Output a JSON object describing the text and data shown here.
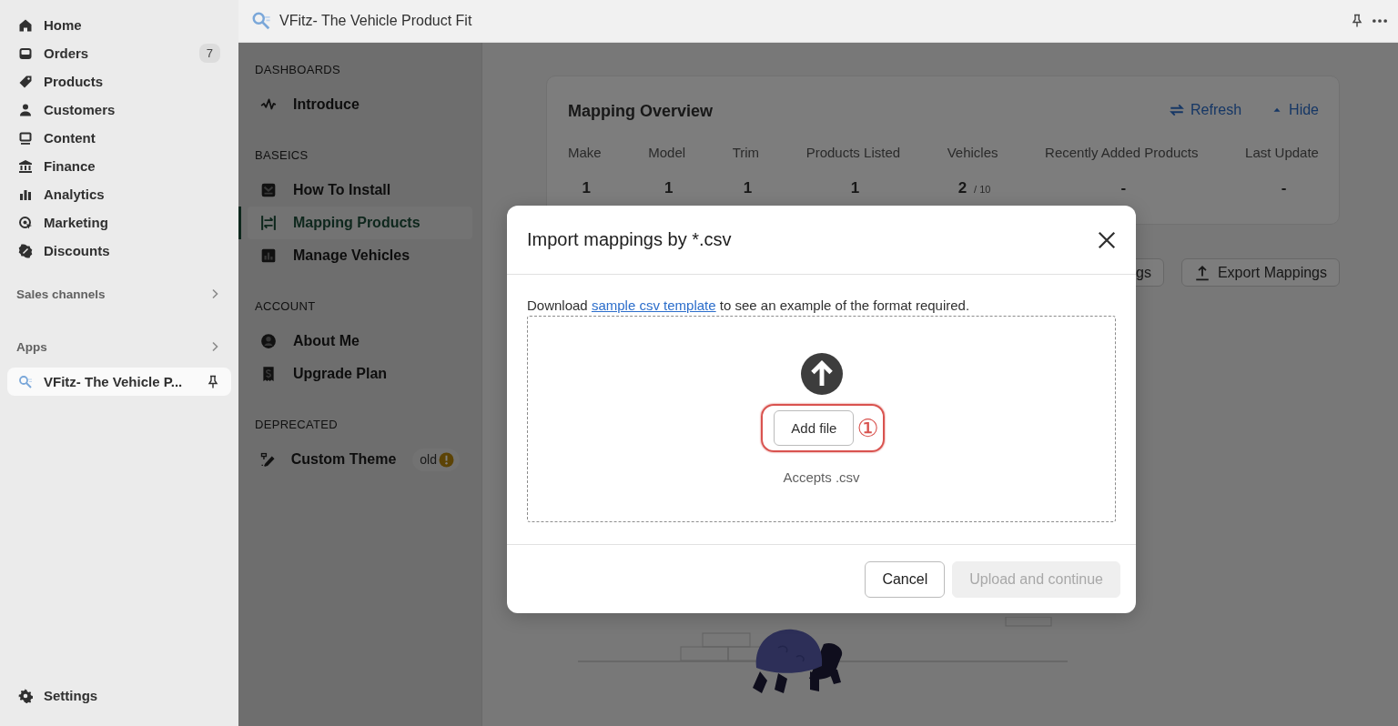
{
  "sidebar": {
    "items": [
      {
        "label": "Home",
        "selected": false
      },
      {
        "label": "Orders",
        "badge": "7",
        "selected": false
      },
      {
        "label": "Products",
        "selected": false
      },
      {
        "label": "Customers",
        "selected": false
      },
      {
        "label": "Content",
        "selected": false
      },
      {
        "label": "Finance",
        "selected": false
      },
      {
        "label": "Analytics",
        "selected": false
      },
      {
        "label": "Marketing",
        "selected": false
      },
      {
        "label": "Discounts",
        "selected": false
      }
    ],
    "sections": [
      {
        "label": "Sales channels"
      },
      {
        "label": "Apps"
      }
    ],
    "pinned_app": {
      "label": "VFitz- The Vehicle P...",
      "selected": true
    },
    "settings": "Settings"
  },
  "header": {
    "title": "VFitz- The Vehicle Product Fit"
  },
  "app_nav": {
    "sections": [
      {
        "heading": "DASHBOARDS",
        "items": [
          {
            "label": "Introduce",
            "selected": false
          }
        ]
      },
      {
        "heading": "BASEICS",
        "items": [
          {
            "label": "How To Install",
            "selected": false
          },
          {
            "label": "Mapping Products",
            "selected": true
          },
          {
            "label": "Manage Vehicles",
            "selected": false
          }
        ]
      },
      {
        "heading": "ACCOUNT",
        "items": [
          {
            "label": "About Me",
            "selected": false
          },
          {
            "label": "Upgrade Plan",
            "selected": false
          }
        ]
      },
      {
        "heading": "DEPRECATED",
        "items": [
          {
            "label": "Custom Theme",
            "badge": "old",
            "selected": false
          }
        ]
      }
    ]
  },
  "overview": {
    "title": "Mapping Overview",
    "actions": [
      "Refresh",
      "Hide"
    ],
    "stats": [
      {
        "label": "Make",
        "value": "1"
      },
      {
        "label": "Model",
        "value": "1"
      },
      {
        "label": "Trim",
        "value": "1"
      },
      {
        "label": "Products Listed",
        "value": "1"
      },
      {
        "label": "Vehicles",
        "value": "2",
        "limit": "/ 10"
      },
      {
        "label": "Recently Added Products",
        "value": "-"
      },
      {
        "label": "Last Update",
        "value": "-"
      }
    ]
  },
  "toolbar": {
    "buttons": [
      "gs",
      "Export Mappings"
    ]
  },
  "modal": {
    "title": "Import mappings by *.csv",
    "intro_before": "Download",
    "link": "sample csv template",
    "intro_after": "to see an example of the format required.",
    "dropzone": {
      "button": "Add file",
      "annotation": "①",
      "hint": "Accepts .csv"
    },
    "buttons": [
      {
        "label": "Cancel",
        "kind": "secondary",
        "disabled": false
      },
      {
        "label": "Upload and continue",
        "kind": "primary",
        "disabled": true
      }
    ]
  }
}
